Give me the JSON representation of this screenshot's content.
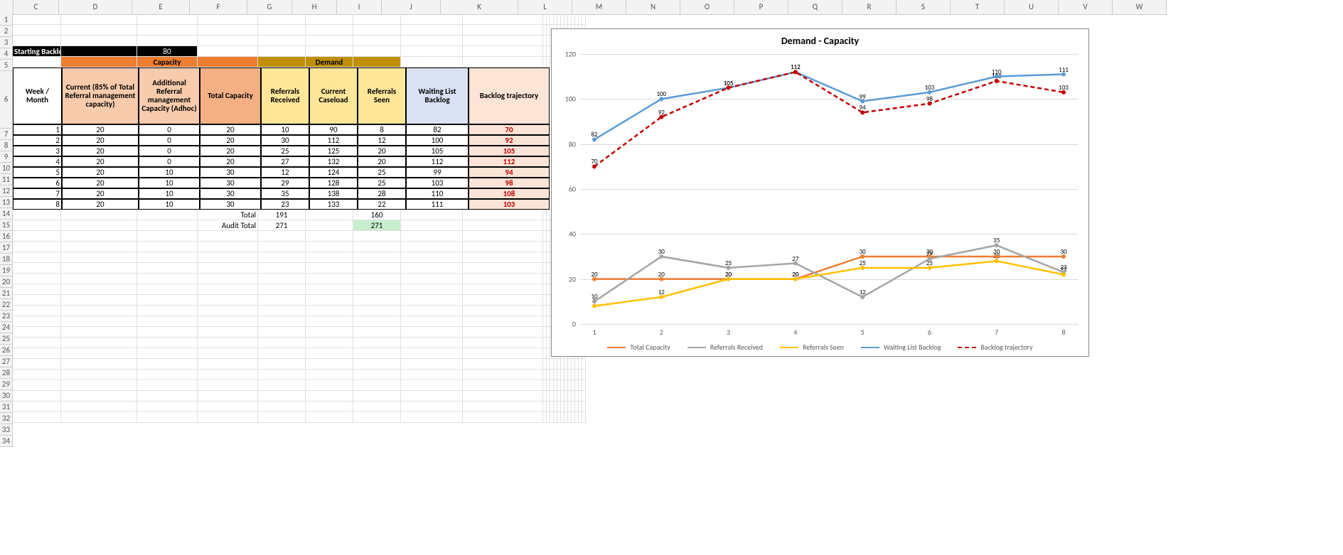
{
  "columns": [
    "C",
    "D",
    "E",
    "F",
    "G",
    "H",
    "I",
    "J",
    "K",
    "L",
    "M",
    "N",
    "O",
    "P",
    "Q",
    "R",
    "S",
    "T",
    "U",
    "V",
    "W"
  ],
  "col_widths": {
    "C": 63,
    "D": 102,
    "E": 80,
    "F": 80,
    "G": 62,
    "H": 62,
    "I": 62,
    "J": 82,
    "K": 108,
    "L": 75,
    "M": 75,
    "N": 75,
    "O": 75,
    "P": 75,
    "Q": 75,
    "R": 75,
    "S": 75,
    "T": 75,
    "U": 75,
    "V": 75,
    "W": 75
  },
  "starting_backlog_label": "Starting Backlog position",
  "starting_backlog_value": "80",
  "capacity_header": "Capacity",
  "demand_header": "Demand",
  "headers": {
    "C": "Week / Month",
    "D": "Current (85% of Total Referral management capacity)",
    "E": "Additional Referral management Capacity (Adhoc)",
    "F": "Total Capacity",
    "G": "Referrals Received",
    "H": "Current Caseload",
    "I": "Referrals Seen",
    "J": "Waiting List Backlog",
    "K": "Backlog trajectory"
  },
  "rows": [
    {
      "C": "1",
      "D": "20",
      "E": "0",
      "F": "20",
      "G": "10",
      "H": "90",
      "I": "8",
      "J": "82",
      "K": "70"
    },
    {
      "C": "2",
      "D": "20",
      "E": "0",
      "F": "20",
      "G": "30",
      "H": "112",
      "I": "12",
      "J": "100",
      "K": "92"
    },
    {
      "C": "3",
      "D": "20",
      "E": "0",
      "F": "20",
      "G": "25",
      "H": "125",
      "I": "20",
      "J": "105",
      "K": "105"
    },
    {
      "C": "4",
      "D": "20",
      "E": "0",
      "F": "20",
      "G": "27",
      "H": "132",
      "I": "20",
      "J": "112",
      "K": "112"
    },
    {
      "C": "5",
      "D": "20",
      "E": "10",
      "F": "30",
      "G": "12",
      "H": "124",
      "I": "25",
      "J": "99",
      "K": "94"
    },
    {
      "C": "6",
      "D": "20",
      "E": "10",
      "F": "30",
      "G": "29",
      "H": "128",
      "I": "25",
      "J": "103",
      "K": "98"
    },
    {
      "C": "7",
      "D": "20",
      "E": "10",
      "F": "30",
      "G": "35",
      "H": "138",
      "I": "28",
      "J": "110",
      "K": "108"
    },
    {
      "C": "8",
      "D": "20",
      "E": "10",
      "F": "30",
      "G": "23",
      "H": "133",
      "I": "22",
      "J": "111",
      "K": "103"
    }
  ],
  "total_label": "Total",
  "total_G": "191",
  "total_I": "160",
  "audit_label": "Audit Total",
  "audit_G": "271",
  "audit_I": "271",
  "chart_data": {
    "type": "line",
    "title": "Demand - Capacity",
    "categories": [
      "1",
      "2",
      "3",
      "4",
      "5",
      "6",
      "7",
      "8"
    ],
    "ylim": [
      0,
      120
    ],
    "yticks": [
      0,
      20,
      40,
      60,
      80,
      100,
      120
    ],
    "series": [
      {
        "name": "Total Capacity",
        "color": "#ED7D31",
        "values": [
          20,
          20,
          20,
          20,
          30,
          30,
          30,
          30
        ]
      },
      {
        "name": "Referrals Received",
        "color": "#A5A5A5",
        "values": [
          10,
          30,
          25,
          27,
          12,
          29,
          35,
          23
        ]
      },
      {
        "name": "Referrals Seen",
        "color": "#FFC000",
        "values": [
          8,
          12,
          20,
          20,
          25,
          25,
          28,
          22
        ]
      },
      {
        "name": "Waiting List Backlog",
        "color": "#5B9BD5",
        "values": [
          82,
          100,
          105,
          112,
          99,
          103,
          110,
          111
        ]
      },
      {
        "name": "Backlog trajectory",
        "color": "#C00000",
        "dashed": true,
        "values": [
          70,
          92,
          105,
          112,
          94,
          98,
          108,
          103
        ]
      }
    ]
  }
}
